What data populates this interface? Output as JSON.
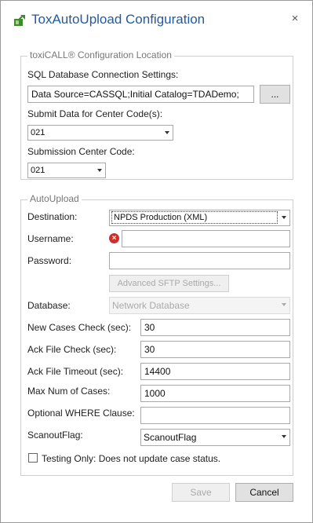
{
  "window": {
    "title": "ToxAutoUpload Configuration",
    "close_glyph": "×"
  },
  "config_group": {
    "legend": "toxiCALL® Configuration Location",
    "sql_label": "SQL Database Connection Settings:",
    "sql_value": "Data Source=CASSQL;Initial Catalog=TDADemo;",
    "browse_label": "...",
    "submit_label": "Submit Data for Center Code(s):",
    "submit_value": "021",
    "center_label": "Submission Center Code:",
    "center_value": "021"
  },
  "autoupload": {
    "legend": "AutoUpload",
    "destination_label": "Destination:",
    "destination_value": "NPDS Production (XML)",
    "username_label": "Username:",
    "username_value": "",
    "password_label": "Password:",
    "password_value": "",
    "sftp_button": "Advanced SFTP Settings...",
    "database_label": "Database:",
    "database_value": "Network Database",
    "new_cases_label": "New Cases Check (sec):",
    "new_cases_value": "30",
    "ack_check_label": "Ack File Check (sec):",
    "ack_check_value": "30",
    "ack_timeout_label": "Ack File Timeout (sec):",
    "ack_timeout_value": "14400",
    "max_cases_label": "Max Num of Cases:",
    "max_cases_value": "1000",
    "where_label": "Optional WHERE Clause:",
    "where_value": "",
    "scanout_label": "ScanoutFlag:",
    "scanout_value": "ScanoutFlag",
    "testing_label": "Testing Only: Does not update case status.",
    "testing_checked": false
  },
  "footer": {
    "save": "Save",
    "cancel": "Cancel"
  },
  "icons": {
    "app": "app-logo-icon",
    "close": "close-icon",
    "error": "error-icon",
    "dropdown": "chevron-down-icon"
  },
  "colors": {
    "title": "#1f5aa6",
    "error": "#d12d2d",
    "app_icon": "#3f8a2e"
  }
}
